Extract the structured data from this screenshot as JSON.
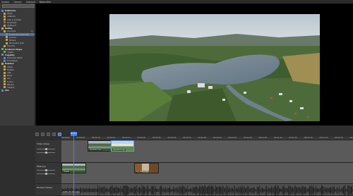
{
  "menu": [
    "Soubor",
    "Úpravy",
    "Zobrazit",
    "Nápověda"
  ],
  "sidebar": {
    "items": [
      {
        "label": "Knihovna",
        "level": 0,
        "hdr": true,
        "icon": "blue"
      },
      {
        "label": "Místa",
        "level": 1,
        "icon": "folder",
        "count": ""
      },
      {
        "label": "Události",
        "level": 1,
        "icon": "folder",
        "count": ""
      },
      {
        "label": "Lidé a zvířata",
        "level": 1,
        "icon": "folder",
        "count": ""
      },
      {
        "label": "Smazané",
        "level": 1,
        "icon": "red",
        "count": ""
      },
      {
        "label": "Oblíbené",
        "level": 1,
        "icon": "folder",
        "count": ""
      },
      {
        "label": "Složky",
        "level": 0,
        "hdr": true,
        "icon": "folder"
      },
      {
        "label": "Dronová",
        "level": 1,
        "icon": "folder",
        "count": "24"
      },
      {
        "label": "Brněnská přehrada",
        "level": 2,
        "icon": "blue",
        "count": "12",
        "sel": true
      },
      {
        "label": "Vranov",
        "level": 2,
        "icon": "folder",
        "count": ""
      },
      {
        "label": "Pálava",
        "level": 2,
        "icon": "folder",
        "count": ""
      },
      {
        "label": "Moravský kras",
        "level": 2,
        "icon": "folder",
        "count": ""
      },
      {
        "label": "Exporty",
        "level": 1,
        "icon": "folder",
        "count": ""
      },
      {
        "label": "Zvuková stopa",
        "level": 0,
        "hdr": true,
        "icon": "green"
      },
      {
        "label": "Hudba",
        "level": 1,
        "icon": "green",
        "count": ""
      },
      {
        "label": "Projekty",
        "level": 0,
        "hdr": true,
        "icon": "blue"
      },
      {
        "label": "Přehrada 2023",
        "level": 1,
        "icon": "blue",
        "count": ""
      },
      {
        "label": "Timelapse",
        "level": 1,
        "icon": "blue",
        "count": ""
      },
      {
        "label": "Kolekce",
        "level": 0,
        "hdr": true,
        "icon": "folder"
      },
      {
        "label": "Výběr",
        "level": 1,
        "icon": "folder",
        "count": ""
      },
      {
        "label": "Podzim",
        "level": 1,
        "icon": "folder",
        "count": ""
      },
      {
        "label": "Léto",
        "level": 1,
        "icon": "folder",
        "count": ""
      },
      {
        "label": "Zima",
        "level": 1,
        "icon": "folder",
        "count": ""
      },
      {
        "label": "Jaro",
        "level": 1,
        "icon": "folder",
        "count": ""
      },
      {
        "label": "Archiv",
        "level": 1,
        "icon": "folder",
        "count": ""
      },
      {
        "label": "Zálohy",
        "level": 1,
        "icon": "folder",
        "count": ""
      },
      {
        "label": "Ostatní",
        "level": 1,
        "icon": "folder",
        "count": ""
      },
      {
        "label": "Vše",
        "level": 0,
        "hdr": true,
        "icon": "blue"
      }
    ]
  },
  "timeline": {
    "ruler_ticks": [
      "00:00:00",
      "00:00:05",
      "00:00:10",
      "00:00:15",
      "00:00:20",
      "00:00:25",
      "00:00:30",
      "00:00:35",
      "00:00:40",
      "00:00:45",
      "00:00:50",
      "00:00:55",
      "00:01:00",
      "00:01:05",
      "00:01:10",
      "00:01:15",
      "00:01:20",
      "00:01:25",
      "00:01:30",
      "00:01:35"
    ],
    "playhead_label": "00:00:08",
    "tracks": [
      {
        "name": "Video stopa",
        "clips": [
          {
            "label": "DJI_0012.mp4",
            "start": 0.09,
            "width": 0.09,
            "kind": "lake"
          },
          {
            "label": "DJI_0013.mp4",
            "start": 0.17,
            "width": 0.08,
            "kind": "field",
            "sel": true
          }
        ]
      },
      {
        "name": "Překryvy",
        "clips": [
          {
            "label": "Titulek",
            "start": 0.0,
            "width": 0.085,
            "kind": "lake"
          },
          {
            "label": "DJI_0021.mp4",
            "start": 0.25,
            "width": 0.085,
            "kind": "autumn"
          }
        ]
      }
    ],
    "audio": {
      "name": "Hudební stopa",
      "label": "Audio_01_Mix.wav"
    }
  },
  "colors": {
    "accent": "#3b82f6",
    "panel": "#3a3a3a",
    "bg": "#000000"
  }
}
